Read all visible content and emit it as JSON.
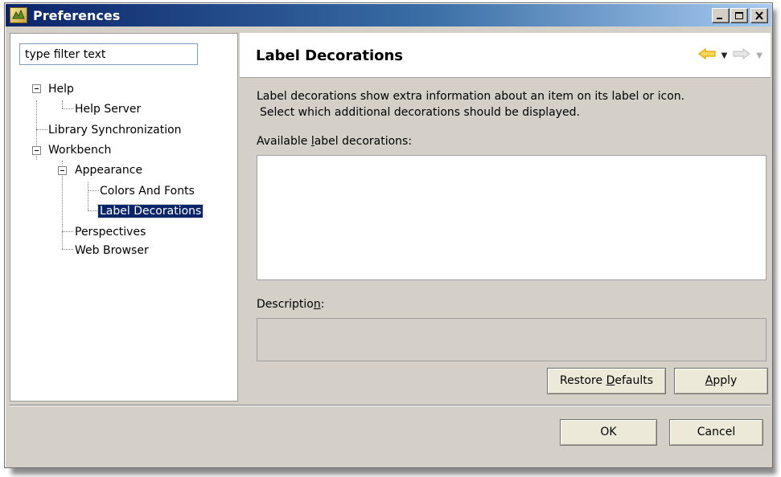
{
  "window": {
    "title": "Preferences",
    "controls": {
      "minimize": "_",
      "maximize": "□",
      "close": "×"
    }
  },
  "filter": {
    "value": "type filter text"
  },
  "tree": {
    "items": [
      {
        "label": "Help",
        "depth": 0,
        "expanded": true
      },
      {
        "label": "Help Server",
        "depth": 1
      },
      {
        "label": "Library Synchronization",
        "depth": 0
      },
      {
        "label": "Workbench",
        "depth": 0,
        "expanded": true
      },
      {
        "label": "Appearance",
        "depth": 1,
        "expanded": true
      },
      {
        "label": "Colors And Fonts",
        "depth": 2
      },
      {
        "label": "Label Decorations",
        "depth": 2,
        "selected": true
      },
      {
        "label": "Perspectives",
        "depth": 1
      },
      {
        "label": "Web Browser",
        "depth": 1
      }
    ]
  },
  "page": {
    "title": "Label Decorations",
    "description_line1": "Label decorations show extra information about an item on its label or icon.",
    "description_line2": "Select which additional decorations should be displayed.",
    "available_label_pre": "Available ",
    "available_label_mnemonic": "l",
    "available_label_post": "abel decorations:",
    "description_label_pre": "Descriptio",
    "description_label_mnemonic": "n",
    "description_label_post": ":"
  },
  "buttons": {
    "restore_pre": "Restore ",
    "restore_mnemonic": "D",
    "restore_post": "efaults",
    "apply_mnemonic": "A",
    "apply_post": "pply",
    "ok": "OK",
    "cancel": "Cancel"
  },
  "colors": {
    "titlebar_start": "#0a246a",
    "titlebar_end": "#a6caf0",
    "selection": "#0a246a",
    "back_arrow": "#f2b600"
  },
  "icons": [
    "app-icon",
    "back-arrow-icon",
    "forward-arrow-icon",
    "dropdown-icon"
  ]
}
